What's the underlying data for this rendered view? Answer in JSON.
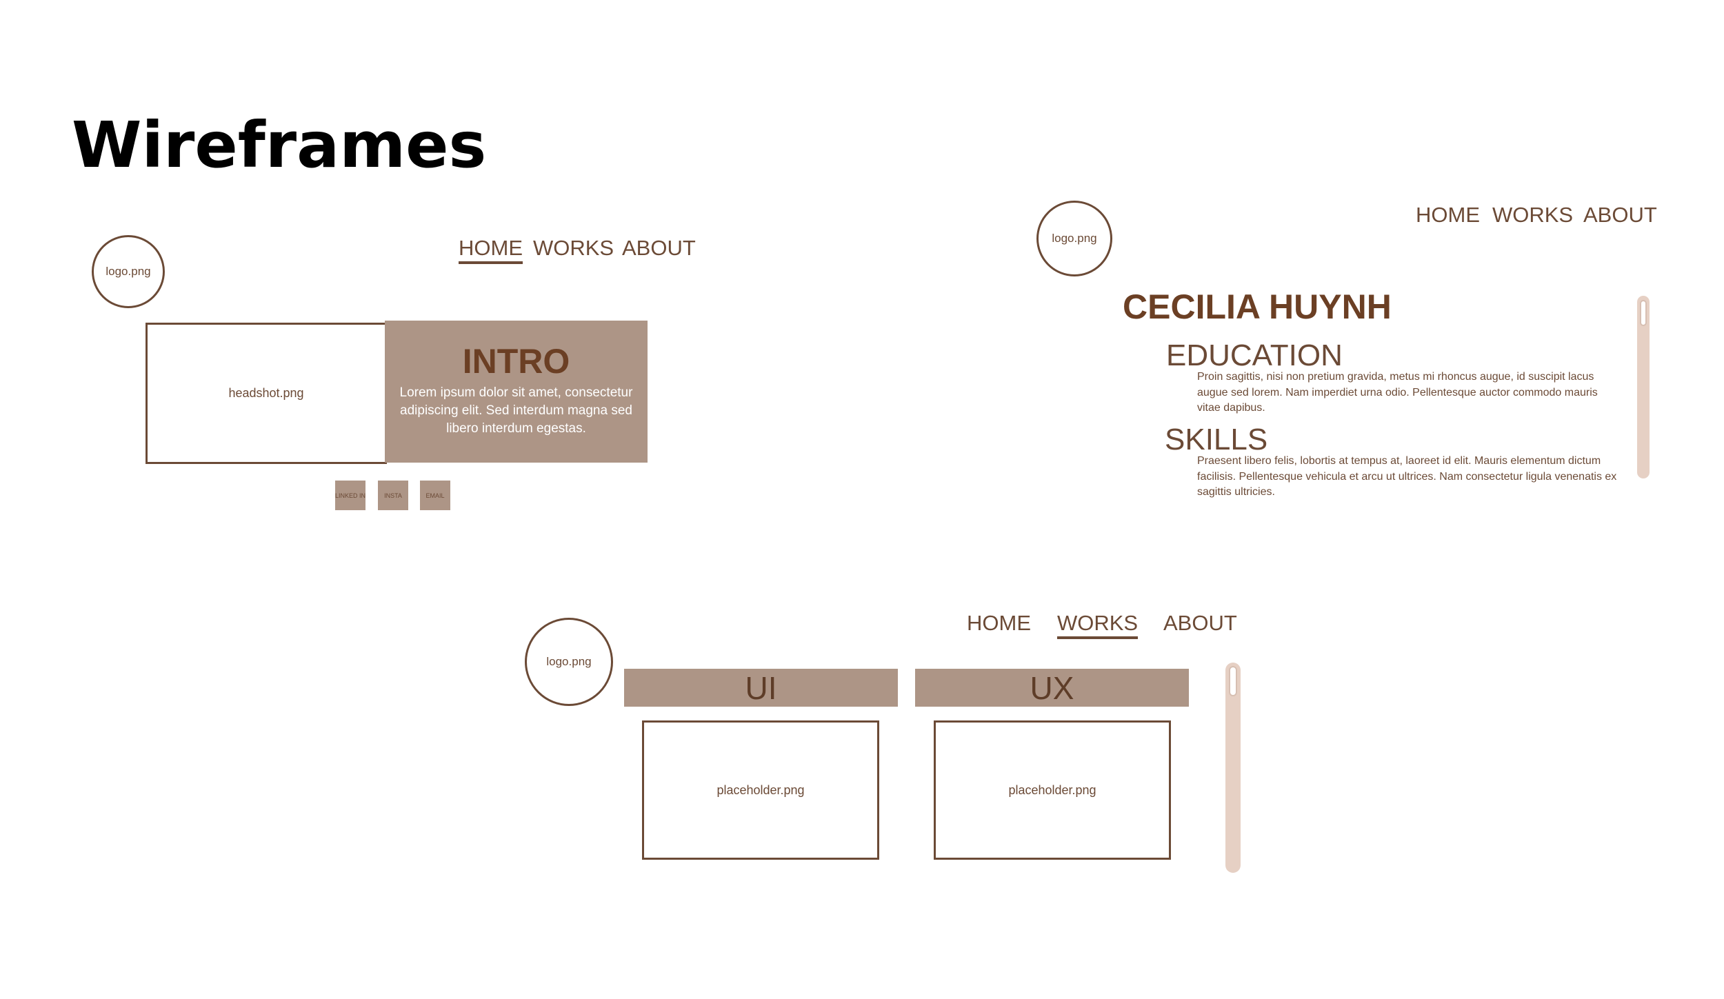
{
  "title": "Wireframes",
  "home": {
    "logo": "logo.png",
    "nav": [
      "HOME",
      "WORKS",
      "ABOUT"
    ],
    "headshot": "headshot.png",
    "intro_title": "INTRO",
    "intro_body": "Lorem ipsum dolor sit amet, consectetur adipiscing elit. Sed interdum magna sed libero interdum egestas.",
    "social": [
      "LINKED IN",
      "INSTA",
      "EMAIL"
    ]
  },
  "about": {
    "logo": "logo.png",
    "nav": [
      "HOME",
      "WORKS",
      "ABOUT"
    ],
    "name": "CECILIA HUYNH",
    "education_heading": "EDUCATION",
    "education_body": "Proin sagittis, nisi non pretium gravida, metus mi rhoncus augue, id suscipit lacus augue sed lorem. Nam imperdiet urna odio. Pellentesque auctor commodo mauris vitae dapibus.",
    "skills_heading": "SKILLS",
    "skills_body": "Praesent libero felis, lobortis at tempus at, laoreet id elit. Mauris elementum dictum facilisis. Pellentesque vehicula et arcu ut ultrices. Nam consectetur ligula venenatis ex sagittis ultricies."
  },
  "works": {
    "logo": "logo.png",
    "nav": [
      "HOME",
      "WORKS",
      "ABOUT"
    ],
    "categories": [
      "UI",
      "UX"
    ],
    "placeholders": [
      "placeholder.png",
      "placeholder.png"
    ]
  },
  "colors": {
    "brown": "#6b4a36",
    "tan": "#ad9586",
    "scroll_track": "#e6d0c4"
  }
}
